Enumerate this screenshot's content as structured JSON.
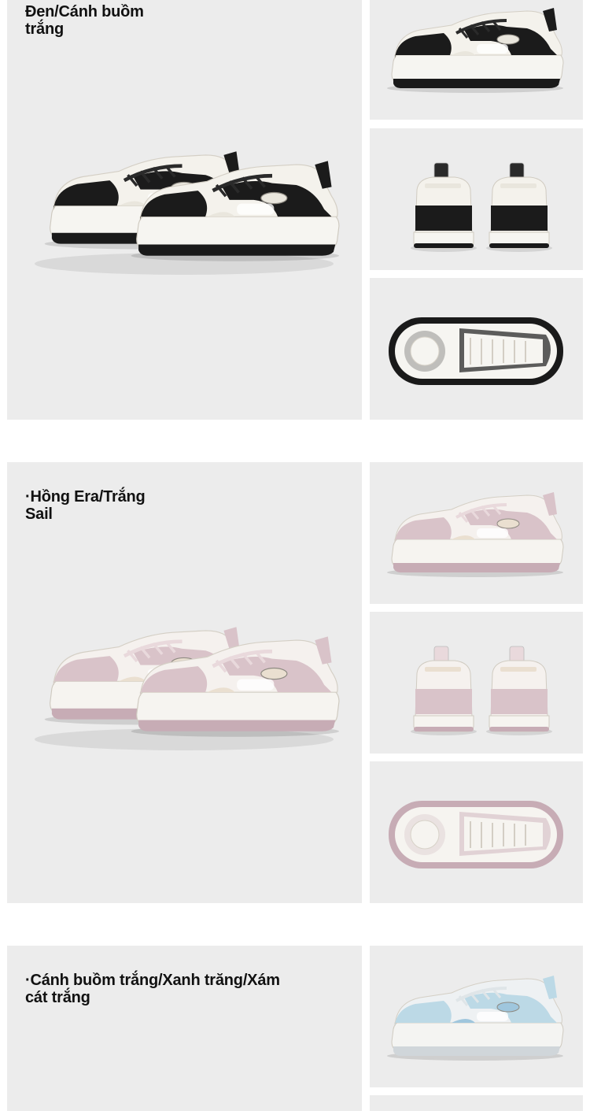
{
  "colorways": [
    {
      "caption": "Đen/Cánh buồm trắng",
      "colors": {
        "upper": "#f4f2ec",
        "overlay": "#1b1b1b",
        "sole": "#f6f5f1",
        "outsole": "#1a1a1a",
        "lace": "#2a2a2a",
        "accent": "#e9e6dd"
      }
    },
    {
      "caption": "·Hồng Era/Trắng Sail",
      "colors": {
        "upper": "#f5f1ee",
        "overlay": "#d9c3c9",
        "sole": "#f6f4f0",
        "outsole": "#c7acb5",
        "lace": "#e9d9dc",
        "accent": "#eadfd0"
      }
    },
    {
      "caption": "·Cánh buồm trắng/Xanh trăng/Xám cát trắng",
      "colors": {
        "upper": "#eef1f3",
        "overlay": "#bcd9e6",
        "sole": "#f4f4f2",
        "outsole": "#d0d6da",
        "lace": "#dfe5e8",
        "accent": "#9fc6dd"
      }
    }
  ]
}
